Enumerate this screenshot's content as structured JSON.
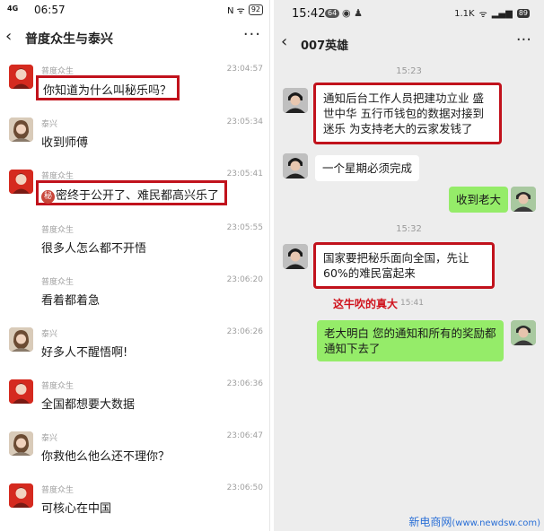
{
  "left": {
    "status": {
      "signal": "4G",
      "time": "06:57",
      "icons": "N ᯤ",
      "battery": "92"
    },
    "nav": {
      "back": "‹",
      "title": "普度众生与泰兴",
      "more": "···"
    },
    "messages": [
      {
        "name": "普度众生",
        "time": "23:04:57",
        "text": "你知道为什么叫秘乐吗？",
        "highlighted": true,
        "avatar": "red-avatar"
      },
      {
        "name": "泰兴",
        "time": "23:05:34",
        "text": "收到师傅",
        "highlighted": false,
        "avatar": "woman-avatar"
      },
      {
        "name": "普度众生",
        "time": "23:05:41",
        "badge": "秘",
        "text": "密终于公开了、难民都高兴乐了",
        "highlighted": true,
        "avatar": "red-avatar"
      },
      {
        "name": "普度众生",
        "time": "23:05:55",
        "text": "很多人怎么都不开悟",
        "highlighted": false,
        "avatar": ""
      },
      {
        "name": "普度众生",
        "time": "23:06:20",
        "text": "看着都着急",
        "highlighted": false,
        "avatar": ""
      },
      {
        "name": "泰兴",
        "time": "23:06:26",
        "text": "好多人不醒悟啊!",
        "highlighted": false,
        "avatar": "woman-avatar"
      },
      {
        "name": "普度众生",
        "time": "23:06:36",
        "text": "全国都想要大数据",
        "highlighted": false,
        "avatar": "red-avatar"
      },
      {
        "name": "泰兴",
        "time": "23:06:47",
        "text": "你救他么他么还不理你？",
        "highlighted": false,
        "avatar": "woman-avatar"
      },
      {
        "name": "普度众生",
        "time": "23:06:50",
        "text": "可核心在中国",
        "highlighted": false,
        "avatar": "red-avatar"
      }
    ]
  },
  "right": {
    "status": {
      "time": "15:42",
      "badge": "64",
      "icons_mid": "◉ ♟",
      "net": "1.1K",
      "battery": "89"
    },
    "nav": {
      "back": "‹",
      "title": "007英雄",
      "more": "···"
    },
    "time1": "15:23",
    "bubble1": "通知后台工作人员把建功立业 盛世中华 五行币钱包的数据对接到迷乐 为支持老大的云家发钱了",
    "bubble2": "一个星期必须完成",
    "bubble3": "收到老大",
    "time2": "15:32",
    "bubble4": "国家要把秘乐面向全国，先让60%的难民富起来",
    "caption": "这牛吹的真大",
    "caption_time": "15:41",
    "bubble5": "老大明白 您的通知和所有的奖励都通知下去了"
  },
  "watermark": {
    "main": "新电商网",
    "url": "(www.newdsw.com)"
  },
  "colors": {
    "highlight_red": "#c1121c",
    "wechat_green": "#95ec69",
    "caption_red": "#d0121c"
  }
}
